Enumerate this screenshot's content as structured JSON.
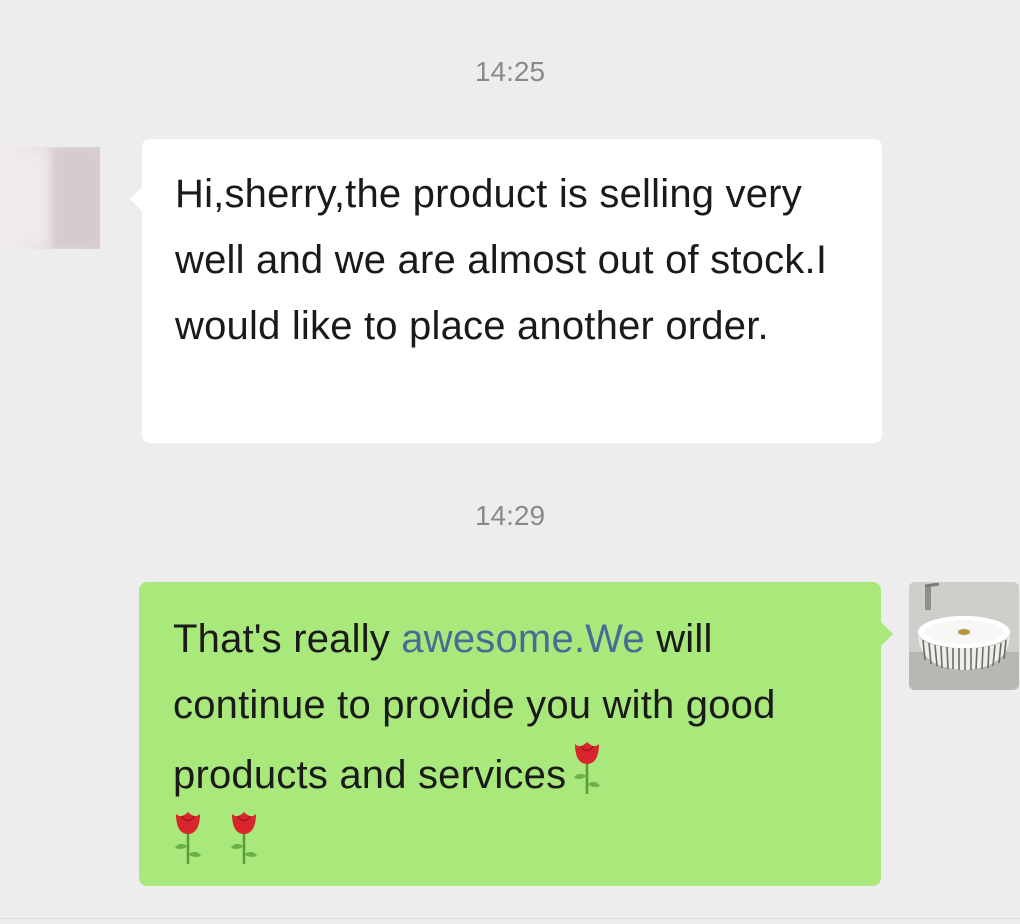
{
  "messages": [
    {
      "timestamp": "14:25",
      "direction": "incoming",
      "text": "Hi,sherry,the product is selling very well and we are almost out of stock.I would like to place another order."
    },
    {
      "timestamp": "14:29",
      "direction": "outgoing",
      "text_before_link": "That's really ",
      "link_text": "awesome.We",
      "text_after_link": " will continue to provide you with good products and services",
      "emoji": [
        "rose",
        "rose",
        "rose"
      ]
    }
  ],
  "colors": {
    "background": "#ededed",
    "incoming_bubble": "#ffffff",
    "outgoing_bubble": "#a9e97c",
    "timestamp": "#8a8a8a",
    "link": "#4a6b95"
  },
  "icons": {
    "incoming_avatar": "blurred-profile-avatar",
    "outgoing_avatar": "ribbed-ceramic-basin-avatar",
    "emoji": "rose-emoji"
  }
}
